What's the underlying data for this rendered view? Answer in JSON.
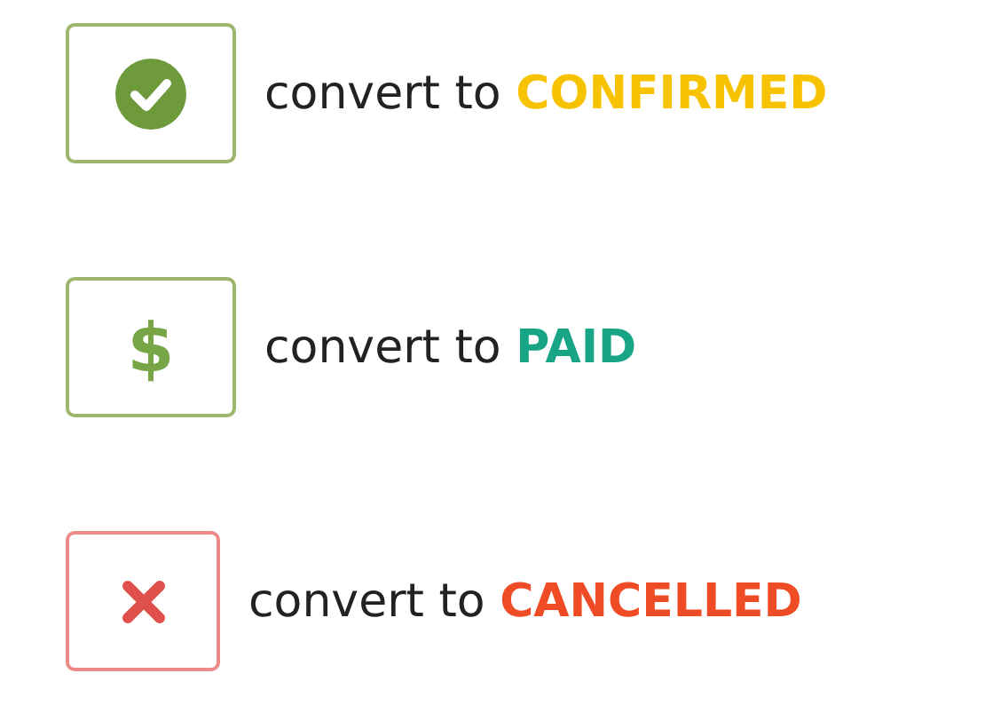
{
  "actions": [
    {
      "kind": "confirm",
      "label": "convert to",
      "status": "CONFIRMED",
      "color": "#f7c300"
    },
    {
      "kind": "pay",
      "icon_text": "$",
      "label": "convert to",
      "status": "PAID",
      "color": "#17a586"
    },
    {
      "kind": "cancel",
      "label": "convert to",
      "status": "CANCELLED",
      "color": "#ef4b24"
    }
  ]
}
